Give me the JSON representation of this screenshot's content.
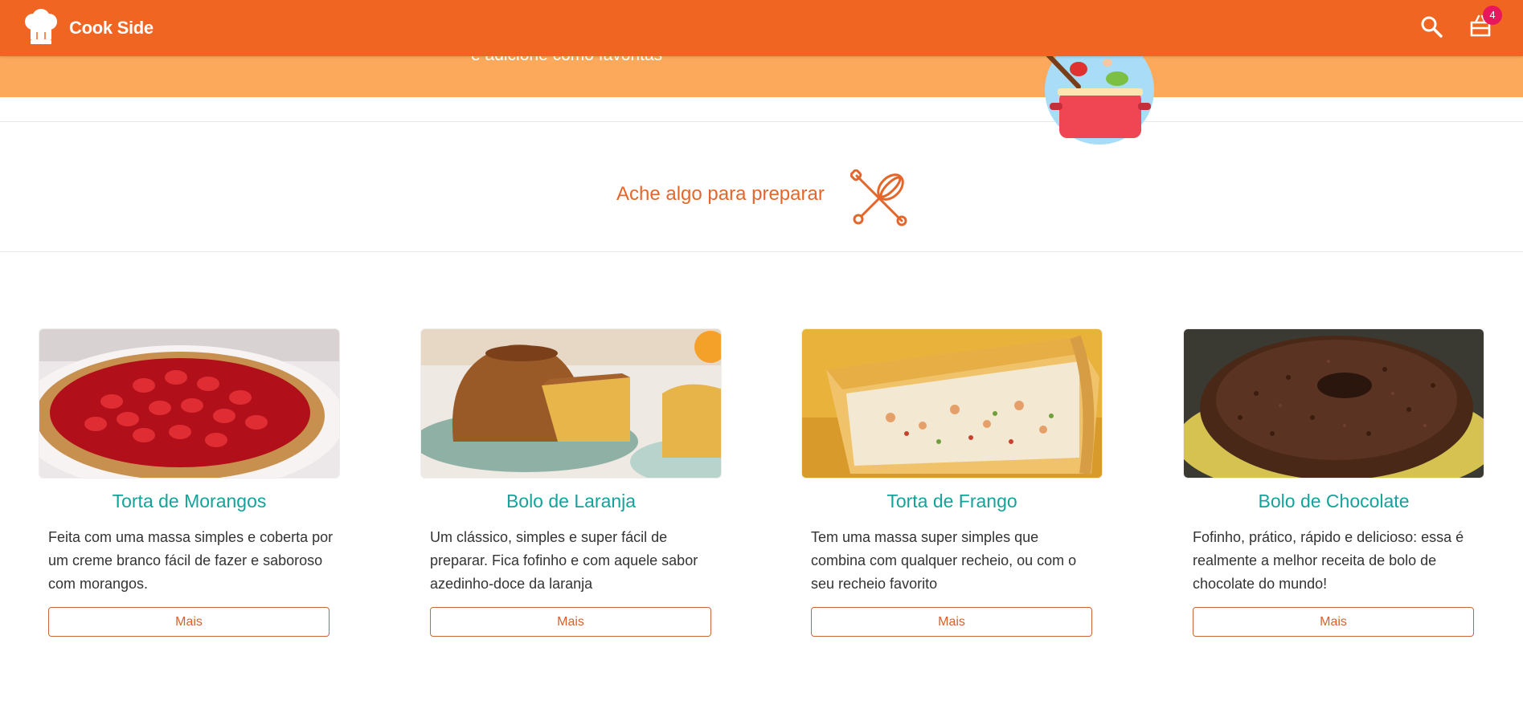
{
  "navbar": {
    "brand": "Cook Side",
    "brand_icon": "chef-hat-icon",
    "search_icon": "search-icon",
    "cart_icon": "basket-icon",
    "cart_count": "4",
    "color": "#f06522"
  },
  "hero": {
    "subtitle": "e adicione como favoritas",
    "illustration": "cooking-pot-icon",
    "color": "#fda95b"
  },
  "find": {
    "title": "Ache algo para preparar",
    "icon": "whisk-rolling-pin-icon"
  },
  "accent_colors": {
    "card_title": "#14a39a",
    "button": "#d8612b",
    "badge": "#e8175d"
  },
  "cards": [
    {
      "title": "Torta de Morangos",
      "text": "Feita com uma massa simples e coberta por um creme branco fácil de fazer e saboroso com morangos.",
      "button": "Mais",
      "image": "strawberry-tart-photo"
    },
    {
      "title": "Bolo de Laranja",
      "text": "Um clássico, simples e super fácil de preparar. Fica fofinho e com aquele sabor azedinho-doce da laranja",
      "button": "Mais",
      "image": "orange-cake-photo"
    },
    {
      "title": "Torta de Frango",
      "text": "Tem uma massa super simples que combina com qualquer recheio, ou com o seu recheio favorito",
      "button": "Mais",
      "image": "chicken-pie-photo"
    },
    {
      "title": "Bolo de Chocolate",
      "text": "Fofinho, prático, rápido e delicioso: essa é realmente a melhor receita de bolo de chocolate do mundo!",
      "button": "Mais",
      "image": "chocolate-cake-photo"
    }
  ]
}
